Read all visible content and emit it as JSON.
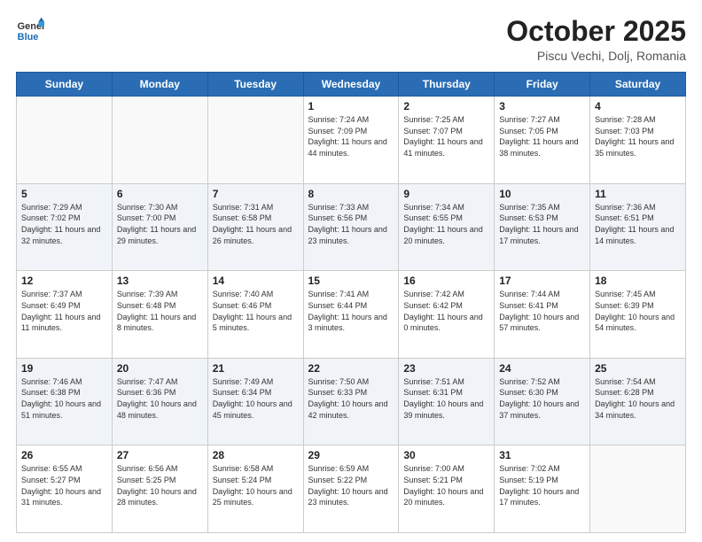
{
  "header": {
    "logo_line1": "General",
    "logo_line2": "Blue",
    "month": "October 2025",
    "location": "Piscu Vechi, Dolj, Romania"
  },
  "weekdays": [
    "Sunday",
    "Monday",
    "Tuesday",
    "Wednesday",
    "Thursday",
    "Friday",
    "Saturday"
  ],
  "weeks": [
    [
      {
        "day": "",
        "sunrise": "",
        "sunset": "",
        "daylight": ""
      },
      {
        "day": "",
        "sunrise": "",
        "sunset": "",
        "daylight": ""
      },
      {
        "day": "",
        "sunrise": "",
        "sunset": "",
        "daylight": ""
      },
      {
        "day": "1",
        "sunrise": "Sunrise: 7:24 AM",
        "sunset": "Sunset: 7:09 PM",
        "daylight": "Daylight: 11 hours and 44 minutes."
      },
      {
        "day": "2",
        "sunrise": "Sunrise: 7:25 AM",
        "sunset": "Sunset: 7:07 PM",
        "daylight": "Daylight: 11 hours and 41 minutes."
      },
      {
        "day": "3",
        "sunrise": "Sunrise: 7:27 AM",
        "sunset": "Sunset: 7:05 PM",
        "daylight": "Daylight: 11 hours and 38 minutes."
      },
      {
        "day": "4",
        "sunrise": "Sunrise: 7:28 AM",
        "sunset": "Sunset: 7:03 PM",
        "daylight": "Daylight: 11 hours and 35 minutes."
      }
    ],
    [
      {
        "day": "5",
        "sunrise": "Sunrise: 7:29 AM",
        "sunset": "Sunset: 7:02 PM",
        "daylight": "Daylight: 11 hours and 32 minutes."
      },
      {
        "day": "6",
        "sunrise": "Sunrise: 7:30 AM",
        "sunset": "Sunset: 7:00 PM",
        "daylight": "Daylight: 11 hours and 29 minutes."
      },
      {
        "day": "7",
        "sunrise": "Sunrise: 7:31 AM",
        "sunset": "Sunset: 6:58 PM",
        "daylight": "Daylight: 11 hours and 26 minutes."
      },
      {
        "day": "8",
        "sunrise": "Sunrise: 7:33 AM",
        "sunset": "Sunset: 6:56 PM",
        "daylight": "Daylight: 11 hours and 23 minutes."
      },
      {
        "day": "9",
        "sunrise": "Sunrise: 7:34 AM",
        "sunset": "Sunset: 6:55 PM",
        "daylight": "Daylight: 11 hours and 20 minutes."
      },
      {
        "day": "10",
        "sunrise": "Sunrise: 7:35 AM",
        "sunset": "Sunset: 6:53 PM",
        "daylight": "Daylight: 11 hours and 17 minutes."
      },
      {
        "day": "11",
        "sunrise": "Sunrise: 7:36 AM",
        "sunset": "Sunset: 6:51 PM",
        "daylight": "Daylight: 11 hours and 14 minutes."
      }
    ],
    [
      {
        "day": "12",
        "sunrise": "Sunrise: 7:37 AM",
        "sunset": "Sunset: 6:49 PM",
        "daylight": "Daylight: 11 hours and 11 minutes."
      },
      {
        "day": "13",
        "sunrise": "Sunrise: 7:39 AM",
        "sunset": "Sunset: 6:48 PM",
        "daylight": "Daylight: 11 hours and 8 minutes."
      },
      {
        "day": "14",
        "sunrise": "Sunrise: 7:40 AM",
        "sunset": "Sunset: 6:46 PM",
        "daylight": "Daylight: 11 hours and 5 minutes."
      },
      {
        "day": "15",
        "sunrise": "Sunrise: 7:41 AM",
        "sunset": "Sunset: 6:44 PM",
        "daylight": "Daylight: 11 hours and 3 minutes."
      },
      {
        "day": "16",
        "sunrise": "Sunrise: 7:42 AM",
        "sunset": "Sunset: 6:42 PM",
        "daylight": "Daylight: 11 hours and 0 minutes."
      },
      {
        "day": "17",
        "sunrise": "Sunrise: 7:44 AM",
        "sunset": "Sunset: 6:41 PM",
        "daylight": "Daylight: 10 hours and 57 minutes."
      },
      {
        "day": "18",
        "sunrise": "Sunrise: 7:45 AM",
        "sunset": "Sunset: 6:39 PM",
        "daylight": "Daylight: 10 hours and 54 minutes."
      }
    ],
    [
      {
        "day": "19",
        "sunrise": "Sunrise: 7:46 AM",
        "sunset": "Sunset: 6:38 PM",
        "daylight": "Daylight: 10 hours and 51 minutes."
      },
      {
        "day": "20",
        "sunrise": "Sunrise: 7:47 AM",
        "sunset": "Sunset: 6:36 PM",
        "daylight": "Daylight: 10 hours and 48 minutes."
      },
      {
        "day": "21",
        "sunrise": "Sunrise: 7:49 AM",
        "sunset": "Sunset: 6:34 PM",
        "daylight": "Daylight: 10 hours and 45 minutes."
      },
      {
        "day": "22",
        "sunrise": "Sunrise: 7:50 AM",
        "sunset": "Sunset: 6:33 PM",
        "daylight": "Daylight: 10 hours and 42 minutes."
      },
      {
        "day": "23",
        "sunrise": "Sunrise: 7:51 AM",
        "sunset": "Sunset: 6:31 PM",
        "daylight": "Daylight: 10 hours and 39 minutes."
      },
      {
        "day": "24",
        "sunrise": "Sunrise: 7:52 AM",
        "sunset": "Sunset: 6:30 PM",
        "daylight": "Daylight: 10 hours and 37 minutes."
      },
      {
        "day": "25",
        "sunrise": "Sunrise: 7:54 AM",
        "sunset": "Sunset: 6:28 PM",
        "daylight": "Daylight: 10 hours and 34 minutes."
      }
    ],
    [
      {
        "day": "26",
        "sunrise": "Sunrise: 6:55 AM",
        "sunset": "Sunset: 5:27 PM",
        "daylight": "Daylight: 10 hours and 31 minutes."
      },
      {
        "day": "27",
        "sunrise": "Sunrise: 6:56 AM",
        "sunset": "Sunset: 5:25 PM",
        "daylight": "Daylight: 10 hours and 28 minutes."
      },
      {
        "day": "28",
        "sunrise": "Sunrise: 6:58 AM",
        "sunset": "Sunset: 5:24 PM",
        "daylight": "Daylight: 10 hours and 25 minutes."
      },
      {
        "day": "29",
        "sunrise": "Sunrise: 6:59 AM",
        "sunset": "Sunset: 5:22 PM",
        "daylight": "Daylight: 10 hours and 23 minutes."
      },
      {
        "day": "30",
        "sunrise": "Sunrise: 7:00 AM",
        "sunset": "Sunset: 5:21 PM",
        "daylight": "Daylight: 10 hours and 20 minutes."
      },
      {
        "day": "31",
        "sunrise": "Sunrise: 7:02 AM",
        "sunset": "Sunset: 5:19 PM",
        "daylight": "Daylight: 10 hours and 17 minutes."
      },
      {
        "day": "",
        "sunrise": "",
        "sunset": "",
        "daylight": ""
      }
    ]
  ]
}
